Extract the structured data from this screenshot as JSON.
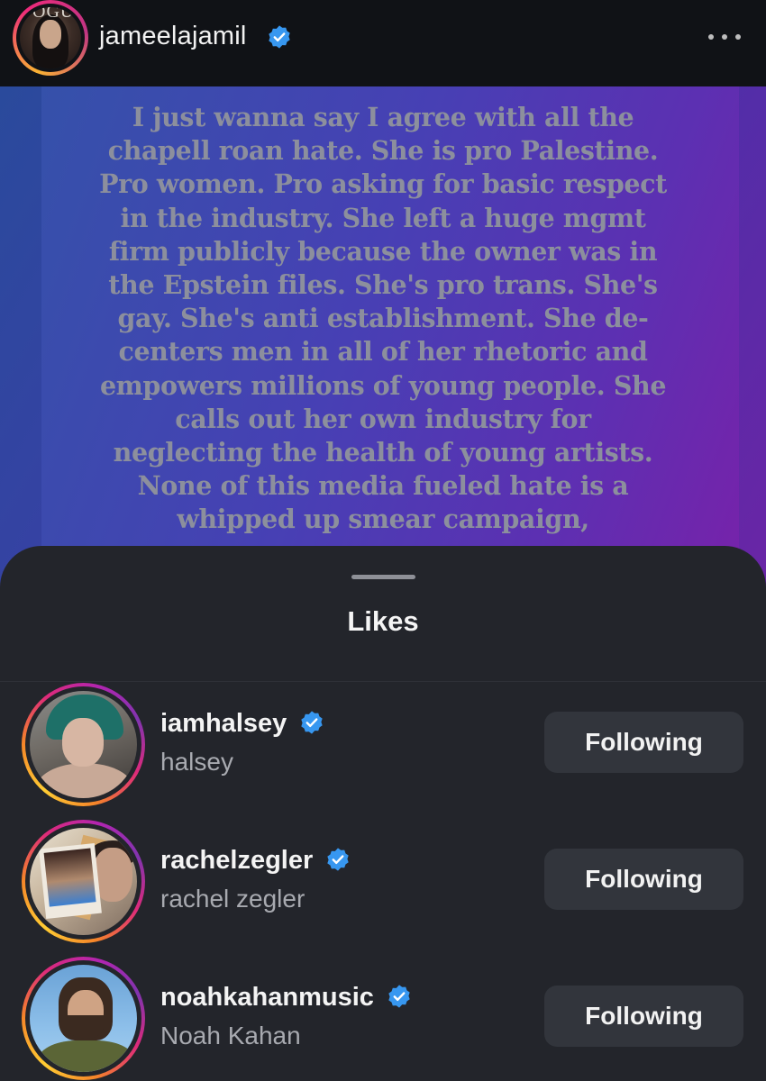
{
  "header": {
    "username": "jameelajamil",
    "verified": true,
    "avatar_overlay_text": "OGUE",
    "more_icon": "more-horizontal-icon"
  },
  "story": {
    "lines": [
      "I just wanna say I agree with all the",
      "chapell roan hate. She is pro Palestine.",
      "Pro women. Pro asking for basic respect",
      "in the industry. She left a huge mgmt",
      "firm publicly because the owner was in",
      "the Epstein files. She's pro trans. She's",
      "gay. She's anti establishment. She de-",
      "centers men in all of her rhetoric and",
      "empowers millions of young people. She",
      "calls out her own industry for",
      "neglecting the health of young artists.",
      "None of this media fueled hate is a",
      "whipped up smear campaign,"
    ]
  },
  "likes_sheet": {
    "title": "Likes",
    "users": [
      {
        "handle": "iamhalsey",
        "name": "halsey",
        "verified": true,
        "button_label": "Following"
      },
      {
        "handle": "rachelzegler",
        "name": "rachel zegler",
        "verified": true,
        "button_label": "Following"
      },
      {
        "handle": "noahkahanmusic",
        "name": "Noah Kahan",
        "verified": true,
        "button_label": "Following"
      }
    ]
  },
  "colors": {
    "verified_badge": "#3797f0",
    "sheet_background": "#23252b",
    "button_background": "#32353c"
  }
}
